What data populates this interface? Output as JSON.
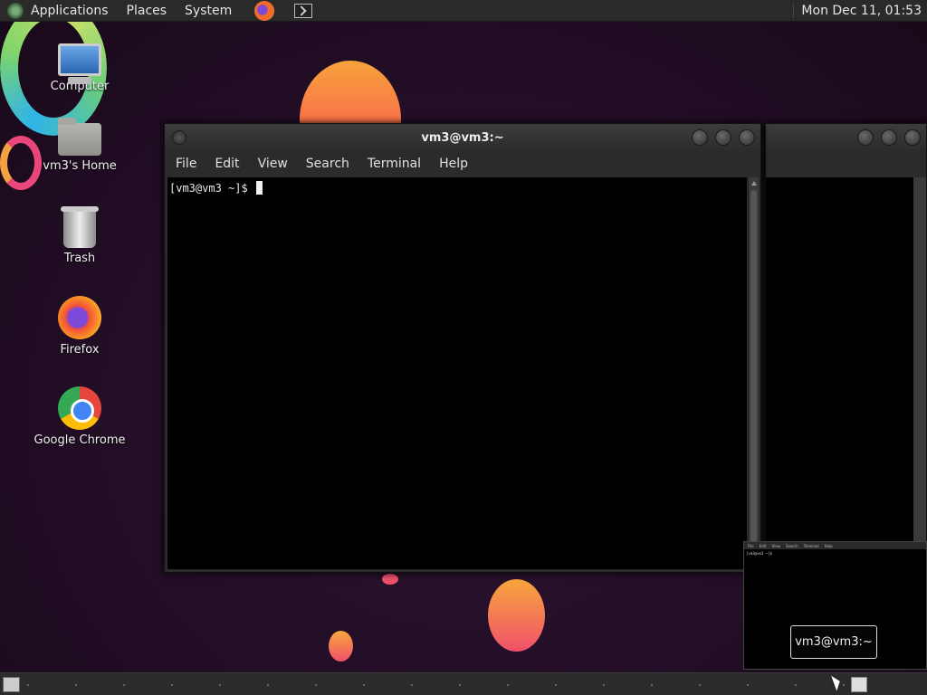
{
  "top_panel": {
    "menus": [
      "Applications",
      "Places",
      "System"
    ],
    "clock": "Mon Dec 11, 01:53"
  },
  "desktop_icons": [
    {
      "label": "Computer",
      "icon": "computer-icon"
    },
    {
      "label": "vm3's Home",
      "icon": "home-folder-icon"
    },
    {
      "label": "Trash",
      "icon": "trash-icon"
    },
    {
      "label": "Firefox",
      "icon": "firefox-icon"
    },
    {
      "label": "Google Chrome",
      "icon": "chrome-icon"
    }
  ],
  "terminal": {
    "title": "vm3@vm3:~",
    "menu": [
      "File",
      "Edit",
      "View",
      "Search",
      "Terminal",
      "Help"
    ],
    "prompt": "[vm3@vm3 ~]$ "
  },
  "preview": {
    "menu": [
      "File",
      "Edit",
      "View",
      "Search",
      "Terminal",
      "Help"
    ],
    "text": "[vm3@vm3 ~]$",
    "tooltip": "vm3@vm3:~"
  },
  "colors": {
    "panel": "#2a2a2a",
    "terminal_bg": "#000000",
    "wallpaper": "#240f26"
  }
}
